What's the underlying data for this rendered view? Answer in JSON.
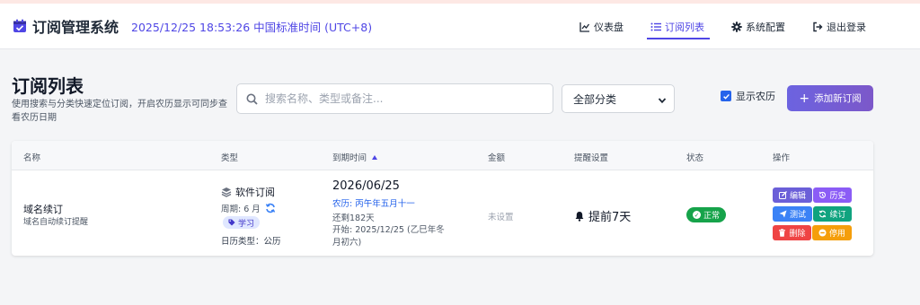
{
  "header": {
    "title": "订阅管理系统",
    "time": "2025/12/25 18:53:26 中国标准时间 (UTC+8)",
    "nav": {
      "dashboard": "仪表盘",
      "list": "订阅列表",
      "config": "系统配置",
      "logout": "退出登录"
    }
  },
  "page": {
    "title": "订阅列表",
    "description": "使用搜索与分类快速定位订阅，开启农历显示可同步查看农历日期"
  },
  "toolbar": {
    "search_placeholder": "搜索名称、类型或备注...",
    "category_selected": "全部分类",
    "show_lunar_label": "显示农历",
    "show_lunar_checked": true,
    "add_button": "添加新订阅"
  },
  "table": {
    "columns": [
      "名称",
      "类型",
      "到期时间",
      "金额",
      "提醒设置",
      "状态",
      "操作"
    ],
    "rows": [
      {
        "name": "域名续订",
        "note": "域名自动续订提醒",
        "type": "软件订阅",
        "period": "周期: 6 月",
        "tag": "学习",
        "calendar_type": "日历类型：公历",
        "expiry_date": "2026/06/25",
        "lunar": "农历: 丙午年五月十一",
        "remaining": "还剩182天",
        "start": "开始: 2025/12/25 (乙巳年冬月初六)",
        "amount": "未设置",
        "reminder": "提前7天",
        "status": "正常",
        "actions": {
          "edit": "编辑",
          "history": "历史",
          "test": "测试",
          "renew": "续订",
          "delete": "删除",
          "disable": "停用"
        }
      }
    ]
  },
  "colors": {
    "accent": "#4f46e5",
    "status_ok": "#16a34a",
    "edit": "#6b5fd8",
    "history": "#8b5cf6",
    "test": "#3b82f6",
    "renew": "#10a37f",
    "delete": "#ef4444",
    "disable": "#f59e0b"
  }
}
